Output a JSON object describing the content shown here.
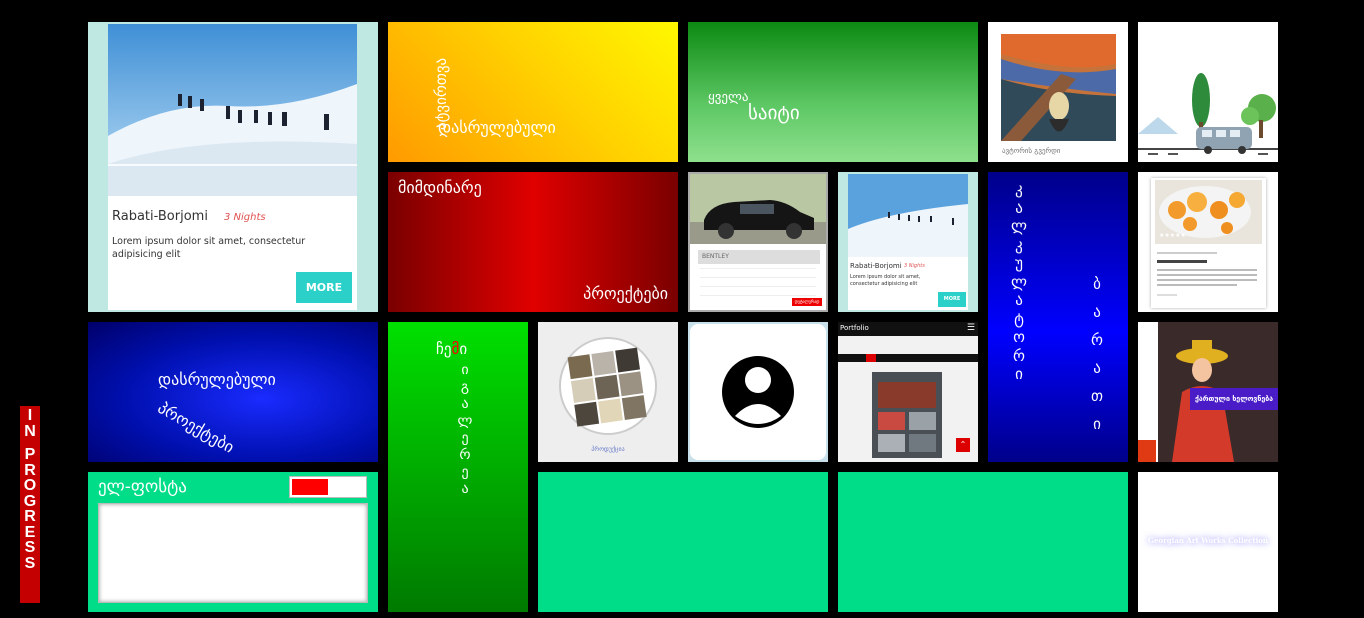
{
  "badge": {
    "text": "IN PROGRESS"
  },
  "tour_card": {
    "title": "Rabati-Borjomi",
    "nights": "3 Nights",
    "desc": "Lorem ipsum dolor sit amet, consectetur adipisicing elit",
    "button": "MORE"
  },
  "tiles": {
    "upload_done": {
      "line1": "ატვირთვა",
      "line2": "დასრულებული"
    },
    "all_sites": {
      "line1": "ყველა",
      "line2": "საიტი"
    },
    "scream_caption": "ავტორის გვერდი",
    "current_projects": {
      "line1": "მიმდინარე",
      "line2": "პროექტები"
    },
    "car_caption": "BENTLEY",
    "car_button": "დეტალურად",
    "mini_tour": {
      "title": "Rabati-Borjomi",
      "nights": "3 Nights",
      "desc": "Lorem ipsum dolor sit amet, consectetur adipisicing elit",
      "button": "MORE"
    },
    "vertical_blue_left": "კალკულატორი",
    "vertical_blue_right": "ბარათი",
    "completed_projects": {
      "line1": "დასრულებული",
      "line2": "პროექტები"
    },
    "my_gallery": "ჩემი გალერეა",
    "gallery_highlight": "მ",
    "tiles_caption": "პროდუქცია",
    "portfolio_header": "Portfolio",
    "portrait_banner": "ქართული ხელოვნება",
    "email": {
      "label": "ელ-ფოსტა"
    },
    "art_collection": "Georgian Art Works Collection"
  },
  "colors": {
    "teal": "#00dd88",
    "badge": "#c40000"
  }
}
